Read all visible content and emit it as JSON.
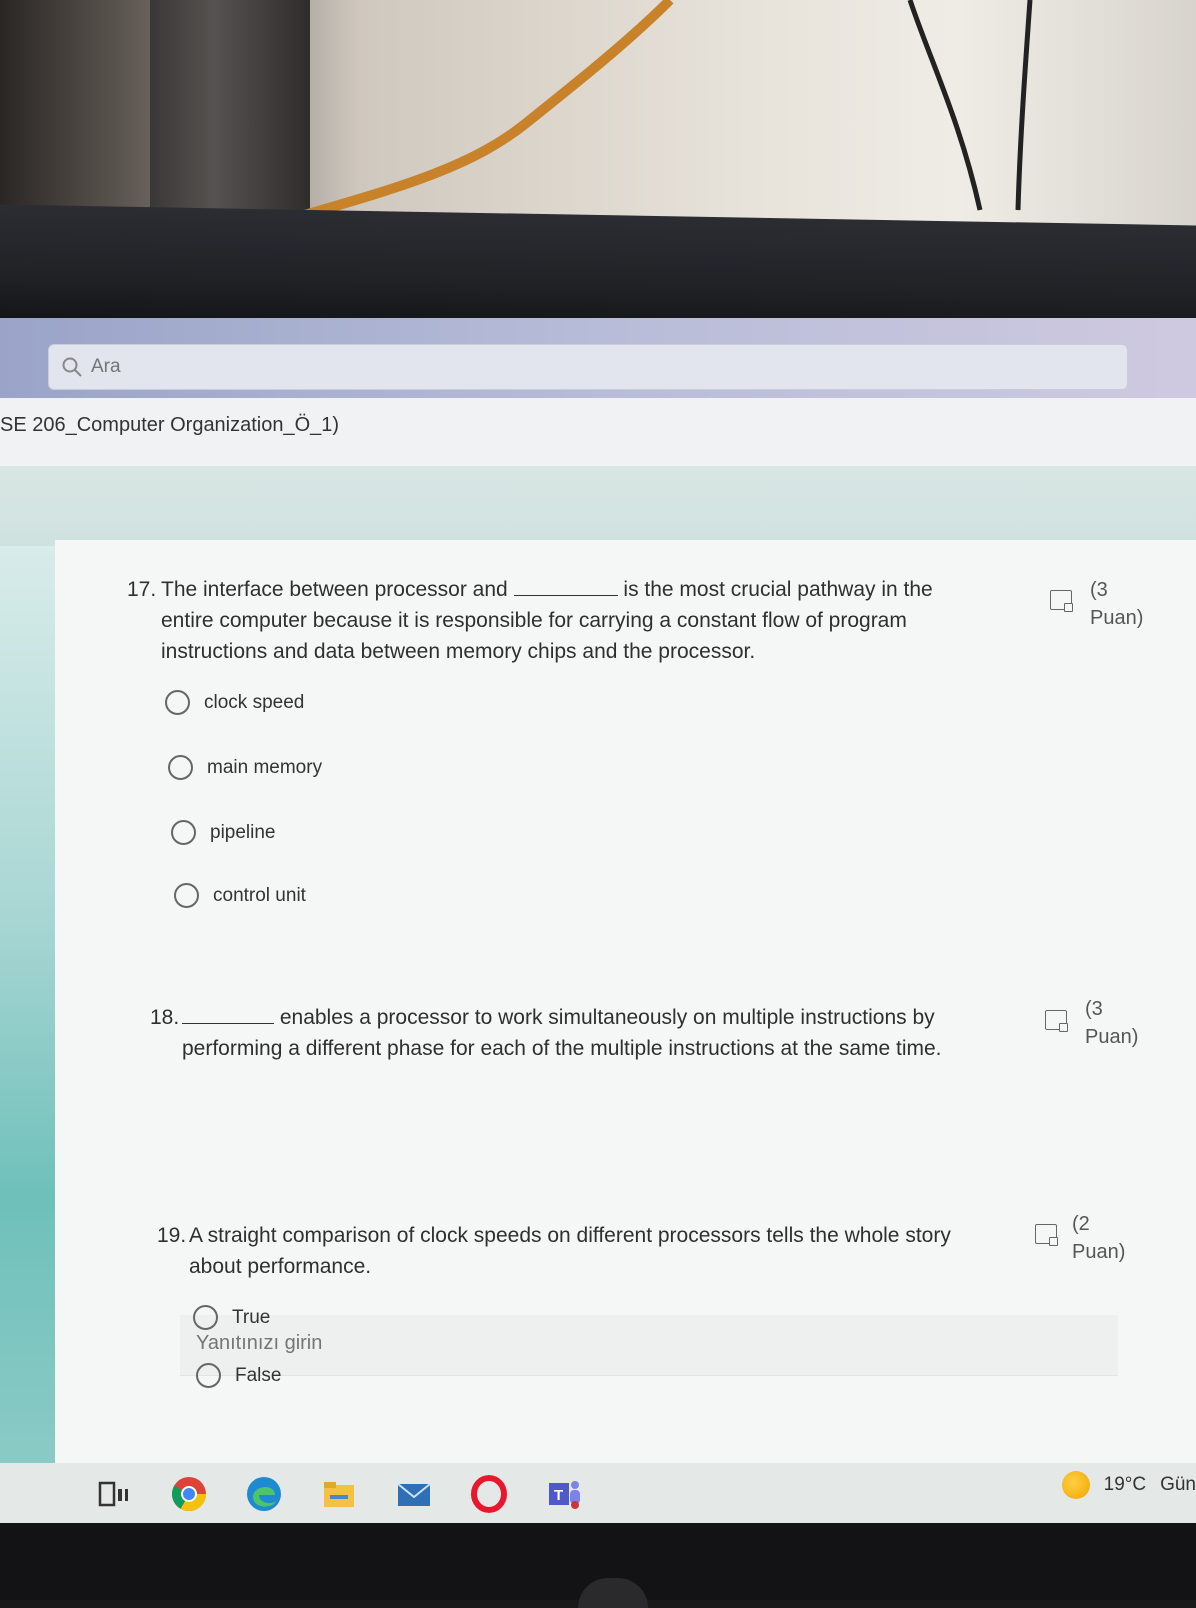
{
  "search": {
    "placeholder": "Ara"
  },
  "form": {
    "title": "SE 206_Computer Organization_Ö_1)"
  },
  "questions": [
    {
      "number": "17.",
      "text_before": "The interface between processor and",
      "text_after": "is the most crucial pathway in the",
      "line2": "entire computer because it is responsible for carrying a constant flow of program",
      "line3": "instructions and data between memory chips and the processor.",
      "points_1": "(3",
      "points_2": "Puan)",
      "options": [
        "clock speed",
        "main memory",
        "pipeline",
        "control unit"
      ]
    },
    {
      "number": "18.",
      "text_after": "enables a processor to work simultaneously on multiple instructions by",
      "line2": "performing a different phase for each of the multiple instructions at the same time.",
      "points_1": "(3",
      "points_2": "Puan)",
      "answer_placeholder": "Yanıtınızı girin"
    },
    {
      "number": "19.",
      "line1": "A straight comparison of clock speeds on different processors tells the whole story",
      "line2": "about performance.",
      "points_1": "(2",
      "points_2": "Puan)",
      "options": [
        "True",
        "False"
      ]
    }
  ],
  "taskbar": {
    "icons": [
      "task-view-icon",
      "chrome-icon",
      "edge-icon",
      "file-explorer-icon",
      "mail-icon",
      "opera-icon",
      "teams-icon"
    ],
    "weather": {
      "temp": "19°C",
      "label": "Gün"
    }
  }
}
